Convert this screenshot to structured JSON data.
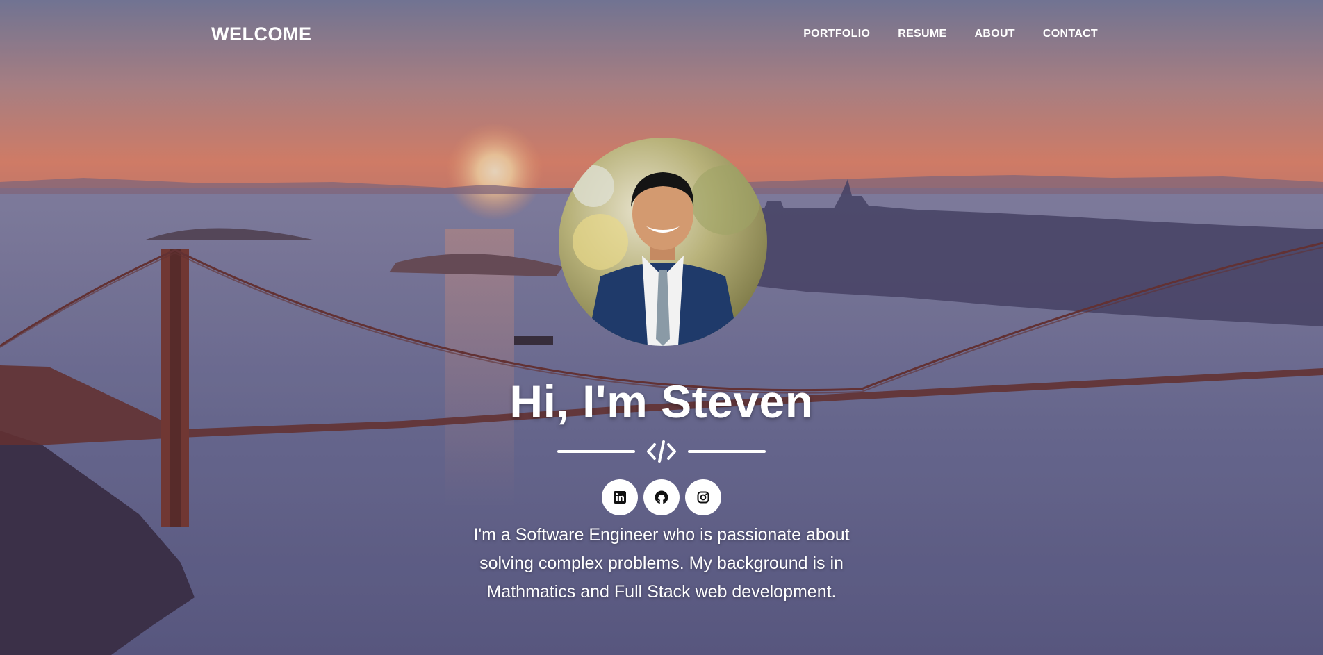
{
  "nav": {
    "brand": "WELCOME",
    "links": [
      {
        "label": "PORTFOLIO"
      },
      {
        "label": "RESUME"
      },
      {
        "label": "ABOUT"
      },
      {
        "label": "CONTACT"
      }
    ]
  },
  "hero": {
    "headline": "Hi, I'm Steven",
    "divider_icon": "code-icon",
    "social": [
      {
        "icon": "linkedin-icon"
      },
      {
        "icon": "github-icon"
      },
      {
        "icon": "instagram-icon"
      }
    ],
    "bio": "I'm a Software Engineer who is passionate about solving complex problems. My background is in Mathmatics and Full Stack web development."
  },
  "colors": {
    "text": "#ffffff",
    "sky_top": "#7a7d9c",
    "sky_sunset": "#e08a6a",
    "water": "#6d6d92",
    "bridge": "#7a3a30"
  }
}
